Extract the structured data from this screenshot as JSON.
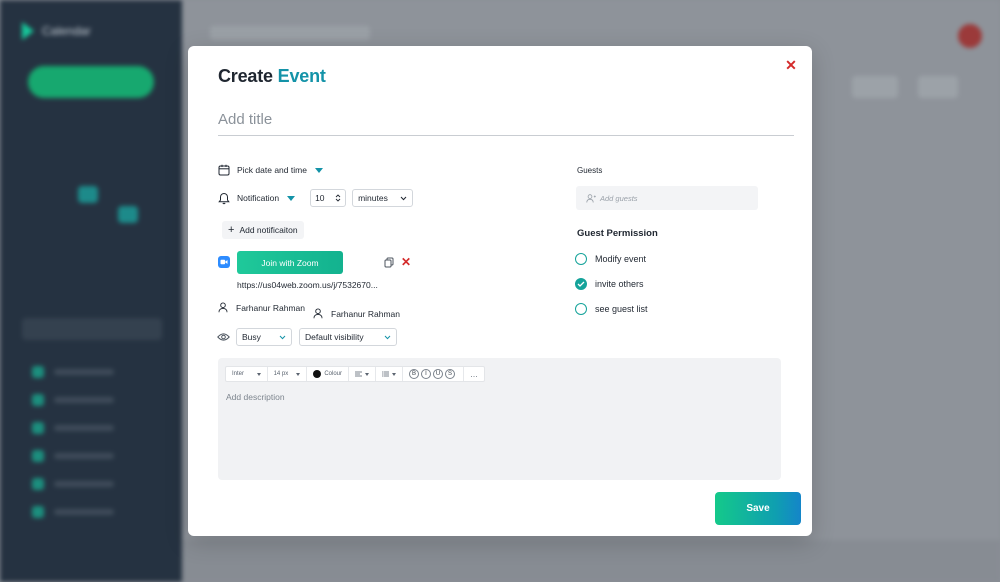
{
  "background": {
    "brand_name": "Calendar"
  },
  "modal": {
    "title_prefix": "Create",
    "title_accent": "Event",
    "title_placeholder": "Add title",
    "date_time_label": "Pick date and time",
    "notification": {
      "label": "Notification",
      "amount": "10",
      "unit": "minutes",
      "add_label": "Add notificaiton"
    },
    "zoom": {
      "button_label": "Join with Zoom",
      "link": "https://us04web.zoom.us/j/7532670..."
    },
    "people": [
      "Farhanur Rahman",
      "Farhanur Rahman"
    ],
    "availability": "Busy",
    "visibility": "Default visibility",
    "editor": {
      "font": "Inter",
      "size": "14 px",
      "color_label": "Colour",
      "format_buttons": [
        "B",
        "I",
        "U",
        "S"
      ],
      "more": "…",
      "placeholder": "Add description"
    },
    "guests": {
      "label": "Guests",
      "placeholder": "Add guests"
    },
    "permissions": {
      "title": "Guest Permission",
      "items": [
        {
          "label": "Modify event",
          "checked": false
        },
        {
          "label": "invite others",
          "checked": true
        },
        {
          "label": "see guest list",
          "checked": false
        }
      ]
    },
    "save_label": "Save"
  },
  "colors": {
    "accent": "#1493a8",
    "close": "#d42a2a",
    "zoom_blue": "#2d8cff",
    "save_gradient_start": "#14c98a",
    "save_gradient_end": "#1485c9"
  }
}
